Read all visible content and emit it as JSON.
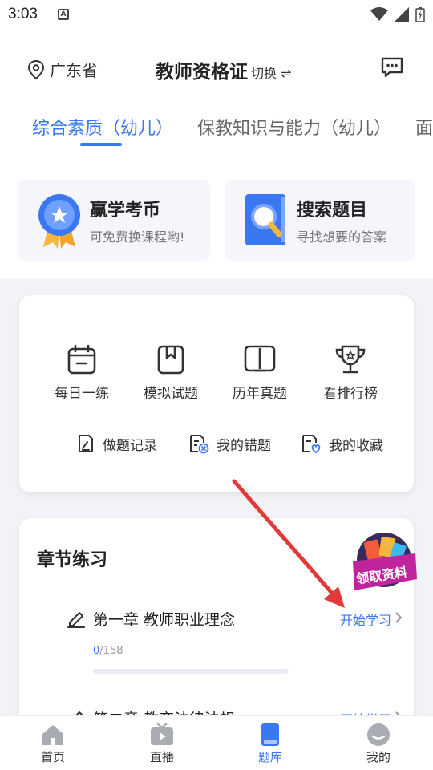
{
  "status_bar": {
    "time": "3:03",
    "notification_icon": "A"
  },
  "header": {
    "location": "广东省",
    "title": "教师资格证",
    "switch_label": "切换 ⇌"
  },
  "tabs": [
    {
      "label": "综合素质（幼儿）",
      "active": true
    },
    {
      "label": "保教知识与能力（幼儿）",
      "active": false
    },
    {
      "label": "面",
      "active": false
    }
  ],
  "promos": [
    {
      "title": "赢学考币",
      "subtitle": "可免费换课程哟!",
      "icon": "medal-icon"
    },
    {
      "title": "搜索题目",
      "subtitle": "寻找想要的答案",
      "icon": "search-book-icon"
    }
  ],
  "tools": [
    {
      "label": "每日一练",
      "icon": "calendar-icon"
    },
    {
      "label": "模拟试题",
      "icon": "bookmark-book-icon"
    },
    {
      "label": "历年真题",
      "icon": "open-book-icon"
    },
    {
      "label": "看排行榜",
      "icon": "trophy-icon"
    }
  ],
  "mini_tools": [
    {
      "label": "做题记录",
      "icon": "record-icon"
    },
    {
      "label": "我的错题",
      "icon": "wrong-answers-icon"
    },
    {
      "label": "我的收藏",
      "icon": "favorites-icon"
    }
  ],
  "chapters": {
    "heading": "章节练习",
    "items": [
      {
        "name": "第一章  教师职业理念",
        "action": "开始学习",
        "done": "0",
        "total": "/158",
        "progress": 0
      },
      {
        "name": "第二章  教育法律法规",
        "action": "开始学习"
      }
    ]
  },
  "badge_text": "领取资料",
  "bottom_nav": [
    {
      "label": "首页",
      "icon": "home-icon",
      "active": false
    },
    {
      "label": "直播",
      "icon": "tv-icon",
      "active": false
    },
    {
      "label": "题库",
      "icon": "question-bank-icon",
      "active": true
    },
    {
      "label": "我的",
      "icon": "profile-icon",
      "active": false
    }
  ],
  "colors": {
    "accent": "#3a78f2",
    "annotation_arrow": "#e03a3a",
    "badge": "#c0249c"
  }
}
